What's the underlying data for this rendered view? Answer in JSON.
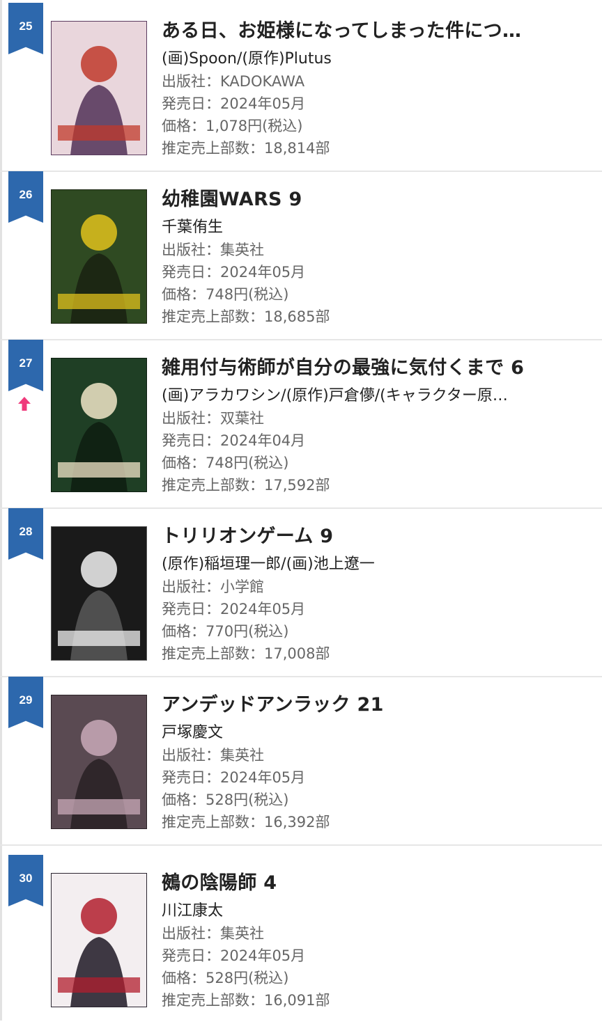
{
  "ranking": {
    "items": [
      {
        "rank": "25",
        "trend": "",
        "title": "ある日、お姫様になってしまった件につ…",
        "author": "(画)Spoon/(原作)Plutus",
        "publisher": "出版社：KADOKAWA",
        "release": "発売日：2024年05月",
        "price": "価格：1,078円(税込)",
        "sales": "推定売上部数：18,814部",
        "cover": {
          "bg": "#e9d6dc",
          "accent": "#c0392b",
          "dark": "#5a3b5e"
        }
      },
      {
        "rank": "26",
        "trend": "",
        "title": "幼稚園WARS 9",
        "author": "千葉侑生",
        "publisher": "出版社：集英社",
        "release": "発売日：2024年05月",
        "price": "価格：748円(税込)",
        "sales": "推定売上部数：18,685部",
        "cover": {
          "bg": "#2f4a22",
          "accent": "#e0c21c",
          "dark": "#1b2412"
        }
      },
      {
        "rank": "27",
        "trend": "up-arrow-icon",
        "title": "雑用付与術師が自分の最強に気付くまで 6",
        "author": "(画)アラカワシン/(原作)戸倉儚/(キャラクター原…",
        "publisher": "出版社：双葉社",
        "release": "発売日：2024年04月",
        "price": "価格：748円(税込)",
        "sales": "推定売上部数：17,592部",
        "cover": {
          "bg": "#1f3f25",
          "accent": "#f1e6c8",
          "dark": "#0e1f12"
        }
      },
      {
        "rank": "28",
        "trend": "",
        "title": "トリリオンゲーム 9",
        "author": "(原作)稲垣理一郎/(画)池上遼一",
        "publisher": "出版社：小学館",
        "release": "発売日：2024年05月",
        "price": "価格：770円(税込)",
        "sales": "推定売上部数：17,008部",
        "cover": {
          "bg": "#1a1a1a",
          "accent": "#f2f2f2",
          "dark": "#555555"
        }
      },
      {
        "rank": "29",
        "trend": "",
        "title": "アンデッドアンラック 21",
        "author": "戸塚慶文",
        "publisher": "出版社：集英社",
        "release": "発売日：2024年05月",
        "price": "価格：528円(税込)",
        "sales": "推定売上部数：16,392部",
        "cover": {
          "bg": "#5a4a52",
          "accent": "#c9a9b8",
          "dark": "#2a2226"
        }
      },
      {
        "rank": "30",
        "trend": "",
        "title": "鵺の陰陽師 4",
        "author": "川江康太",
        "publisher": "出版社：集英社",
        "release": "発売日：2024年05月",
        "price": "価格：528円(税込)",
        "sales": "推定売上部数：16,091部",
        "cover": {
          "bg": "#f3eef0",
          "accent": "#b21e2e",
          "dark": "#2a2430"
        }
      }
    ]
  },
  "colors": {
    "rank_flag": "#2d68ad",
    "trend_up": "#ef3a7b",
    "meta_text": "#666666",
    "title_text": "#222222",
    "divider": "#e6e6e6"
  }
}
